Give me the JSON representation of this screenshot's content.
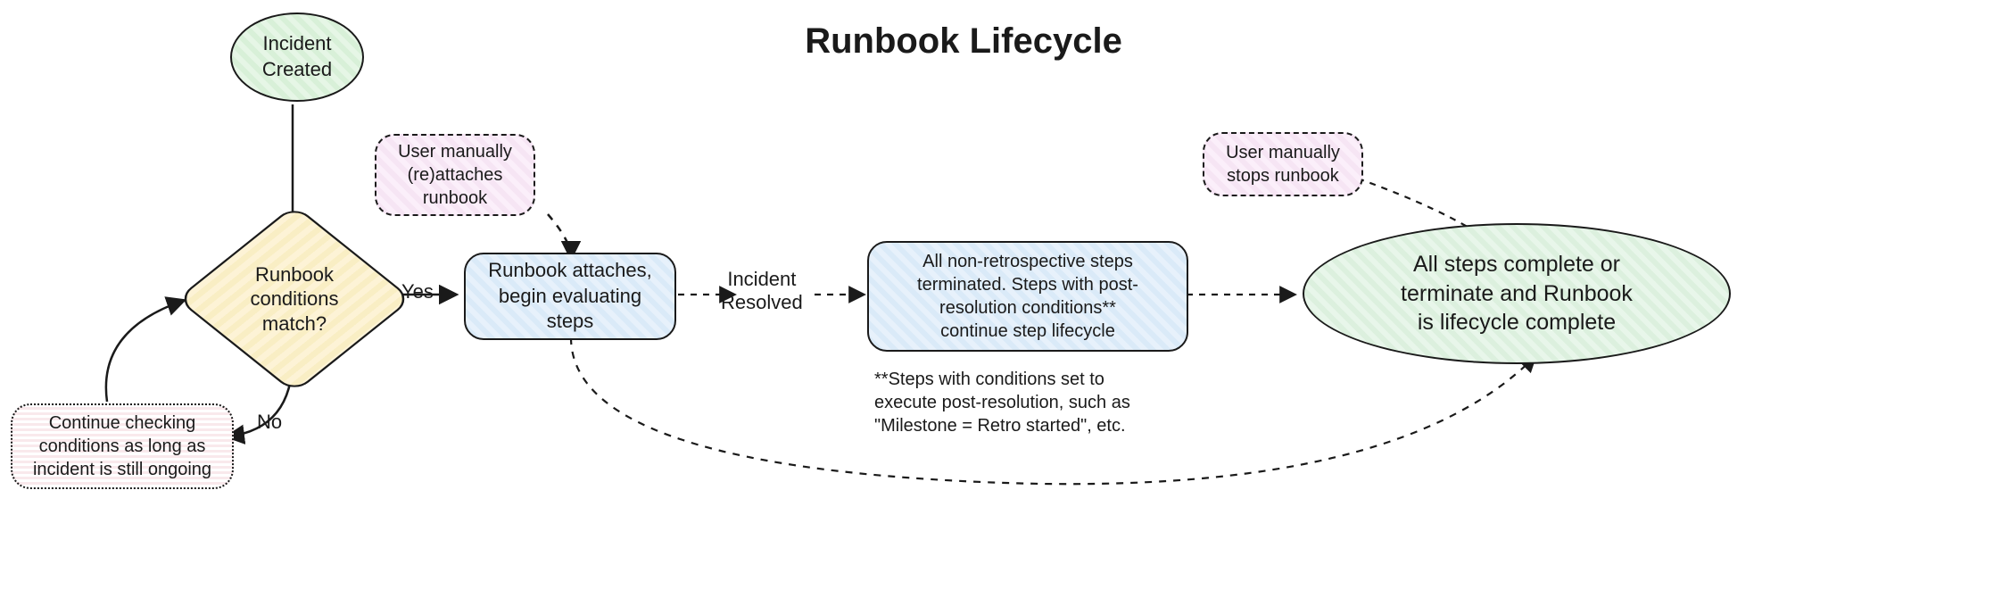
{
  "title": "Runbook Lifecycle",
  "nodes": {
    "start": "Incident\nCreated",
    "decision": "Runbook\nconditions\nmatch?",
    "continue_checking": "Continue checking\nconditions as long as\nincident is still ongoing",
    "manual_attach": "User manually\n(re)attaches\nrunbook",
    "attach_eval": "Runbook attaches,\nbegin evaluating\nsteps",
    "post_resolution": "All non-retrospective steps\nterminated. Steps with post-\nresolution conditions**\ncontinue step lifecycle",
    "manual_stop": "User manually\nstops runbook",
    "complete": "All steps complete or\nterminate and Runbook\nis lifecycle complete"
  },
  "edges": {
    "yes": "Yes",
    "no": "No",
    "incident_resolved": "Incident\nResolved"
  },
  "footnote": "**Steps with conditions set to\nexecute post-resolution, such as\n\"Milestone = Retro started\", etc."
}
